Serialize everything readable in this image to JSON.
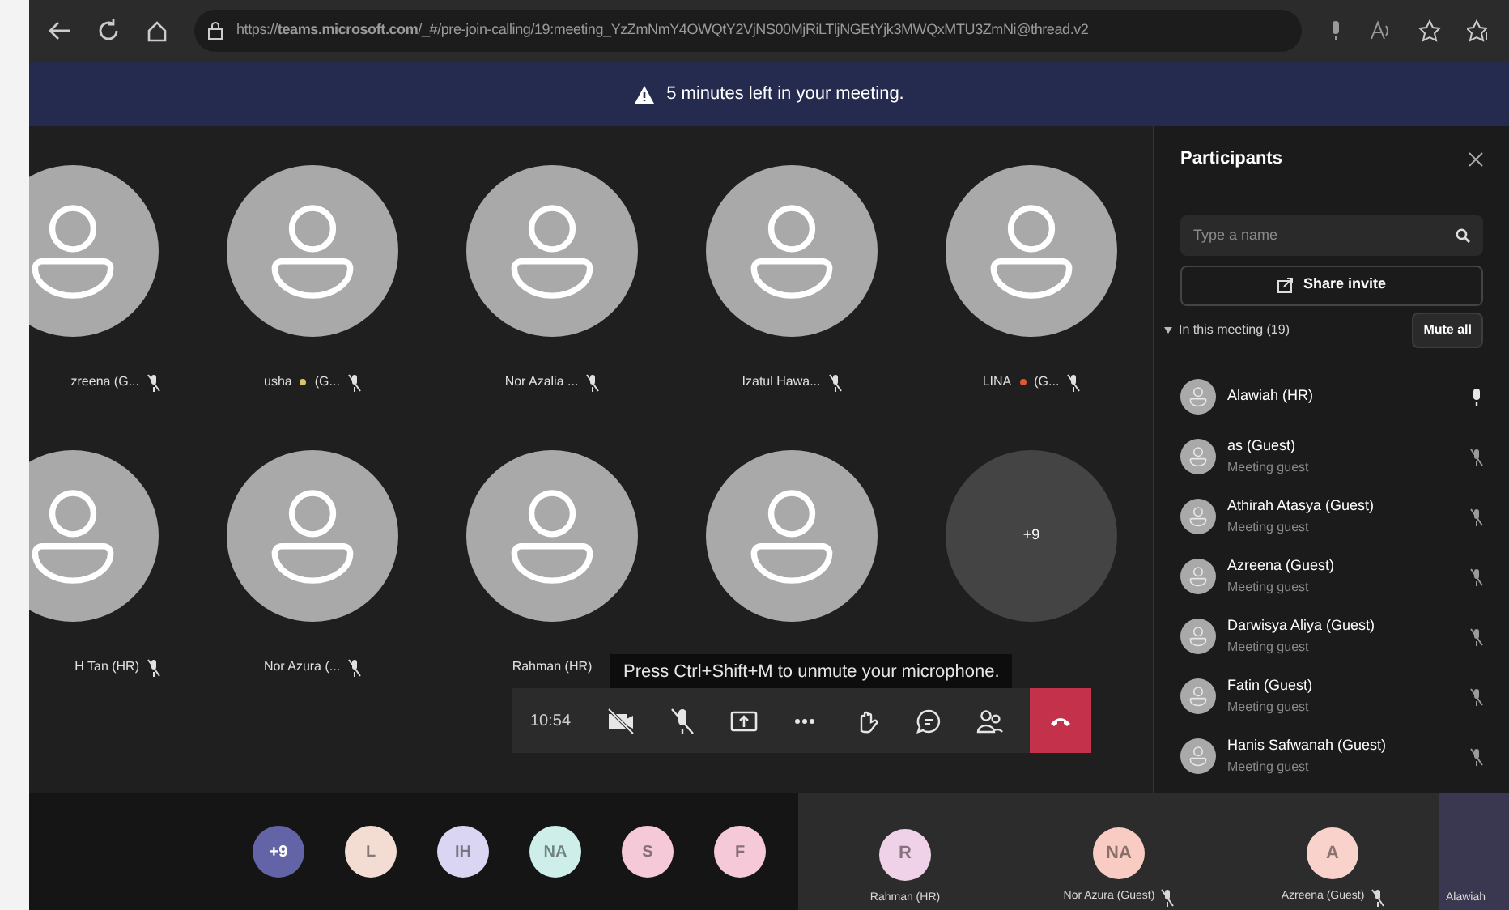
{
  "browser": {
    "url": "https://**teams.microsoft.com**/_#/pre-join-calling/19:meeting_YzZmNmY4OWQtY2VjNS00MjRiLTljNGEtYjk3MWQxMTU3ZmNi@thread.v2"
  },
  "banner": {
    "text": "5 minutes left in your meeting."
  },
  "tiles": [
    {
      "kind": "person",
      "name": "zreena (G...",
      "muted": true
    },
    {
      "kind": "person",
      "name": "usha",
      "color": "#d9c36a",
      "suffix": "(G...",
      "muted": true
    },
    {
      "kind": "person",
      "name": "Nor Azalia ...",
      "muted": true
    },
    {
      "kind": "person",
      "name": "Izatul Hawa...",
      "muted": true
    },
    {
      "kind": "person",
      "name": "LINA",
      "color": "#e2572b",
      "suffix": "(G...",
      "muted": true
    },
    {
      "kind": "person",
      "name": "H Tan (HR)",
      "muted": true
    },
    {
      "kind": "person",
      "name": "Nor Azura (...",
      "muted": true
    },
    {
      "kind": "person",
      "name": "Rahman (HR)"
    },
    {
      "kind": "person"
    },
    {
      "kind": "overflow",
      "count": "+9"
    }
  ],
  "tooltip": "Press Ctrl+Shift+M to unmute your microphone.",
  "toolbar": {
    "time": "10:54",
    "buttons": [
      {
        "kind": "camera-off"
      },
      {
        "kind": "mic-off"
      },
      {
        "kind": "share"
      },
      {
        "kind": "more"
      },
      {
        "kind": "hand"
      },
      {
        "kind": "chat"
      },
      {
        "kind": "people"
      },
      {
        "kind": "hangup"
      }
    ]
  },
  "panel": {
    "title": "Participants",
    "search": {
      "placeholder": "Type a name"
    },
    "share": "Share invite",
    "section": {
      "label": "In this meeting (19)",
      "expanded": true
    },
    "mute_all": "Mute all",
    "people": [
      {
        "name": "Alawiah (HR)",
        "muted": false
      },
      {
        "name": "as (Guest)",
        "subtitle": "Meeting guest",
        "muted": true
      },
      {
        "name": "Athirah Atasya (Guest)",
        "subtitle": "Meeting guest",
        "muted": true
      },
      {
        "name": "Azreena (Guest)",
        "subtitle": "Meeting guest",
        "muted": true
      },
      {
        "name": "Darwisya Aliya (Guest)",
        "subtitle": "Meeting guest",
        "muted": true
      },
      {
        "name": "Fatin (Guest)",
        "subtitle": "Meeting guest",
        "muted": true
      },
      {
        "name": "Hanis Safwanah (Guest)",
        "subtitle": "Meeting guest",
        "muted": true
      }
    ]
  },
  "strip": {
    "avatars": [
      {
        "initials": "+9",
        "color": "#6264a7"
      },
      {
        "initials": "L",
        "color": "#f3dcd2"
      },
      {
        "initials": "IH",
        "color": "#d9d5f2"
      },
      {
        "initials": "NA",
        "color": "#cdeee9"
      },
      {
        "initials": "S",
        "color": "#f6c9d8"
      },
      {
        "initials": "F",
        "color": "#f6c9d8"
      }
    ],
    "videos": [
      {
        "initials": "R",
        "name": "Rahman (HR)",
        "color": "#f0d2e8",
        "muted": false
      },
      {
        "initials": "NA",
        "name": "Nor Azura (Guest)",
        "color": "#f8cbc3",
        "muted": true
      },
      {
        "initials": "A",
        "name": "Azreena (Guest)",
        "color": "#f9d3cb",
        "muted": true
      },
      {
        "name": "Alawiah",
        "muted": false
      }
    ]
  }
}
